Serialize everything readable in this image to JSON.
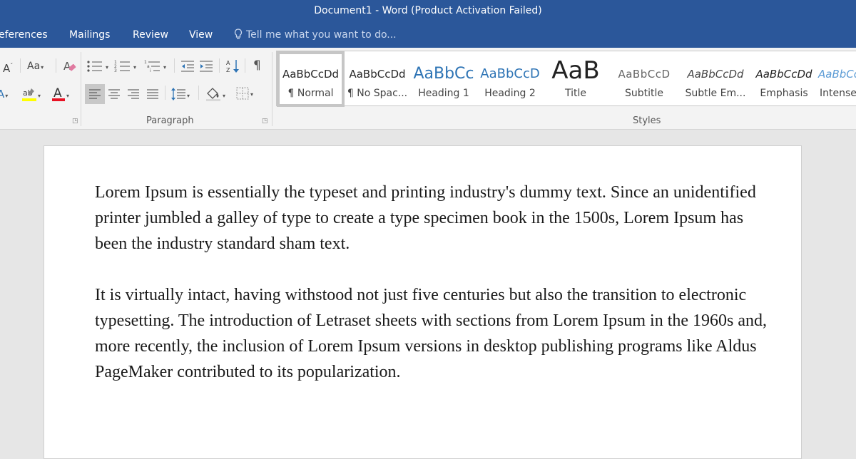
{
  "window": {
    "title": "Document1 - Word (Product Activation Failed)"
  },
  "tabs": [
    "eferences",
    "Mailings",
    "Review",
    "View"
  ],
  "tell_me": {
    "placeholder": "Tell me what you want to do..."
  },
  "ribbon": {
    "font_group": {
      "case_label": "Aa"
    },
    "paragraph_group": {
      "label": "Paragraph"
    },
    "styles_group": {
      "label": "Styles",
      "items": [
        {
          "sample": "AaBbCcDd",
          "name": "¶ Normal",
          "selected": true
        },
        {
          "sample": "AaBbCcDd",
          "name": "¶ No Spac..."
        },
        {
          "sample": "AaBbCc",
          "name": "Heading 1"
        },
        {
          "sample": "AaBbCcD",
          "name": "Heading 2"
        },
        {
          "sample": "AaB",
          "name": "Title"
        },
        {
          "sample": "AaBbCcD",
          "name": "Subtitle"
        },
        {
          "sample": "AaBbCcDd",
          "name": "Subtle Em..."
        },
        {
          "sample": "AaBbCcDd",
          "name": "Emphasis"
        },
        {
          "sample": "AaBbCcD",
          "name": "Intense"
        }
      ]
    }
  },
  "document": {
    "paragraphs": [
      "Lorem Ipsum is essentially the typeset and printing industry's dummy text. Since an unidentified printer jumbled a galley of type to create a type specimen book in the 1500s, Lorem Ipsum has been the industry standard sham text.",
      "It is virtually intact, having withstood not just five centuries but also the transition to electronic typesetting. The introduction of Letraset sheets with sections from Lorem Ipsum in the 1960s and, more recently, the inclusion of Lorem Ipsum versions in desktop publishing programs like Aldus PageMaker contributed to its popularization."
    ]
  },
  "colors": {
    "titlebar": "#2b579a",
    "ribbon_bg": "#f3f3f3",
    "workspace": "#e6e6e6",
    "highlight_yellow": "#ffff00",
    "font_color_red": "#e81123",
    "heading_blue": "#2e74b5"
  }
}
